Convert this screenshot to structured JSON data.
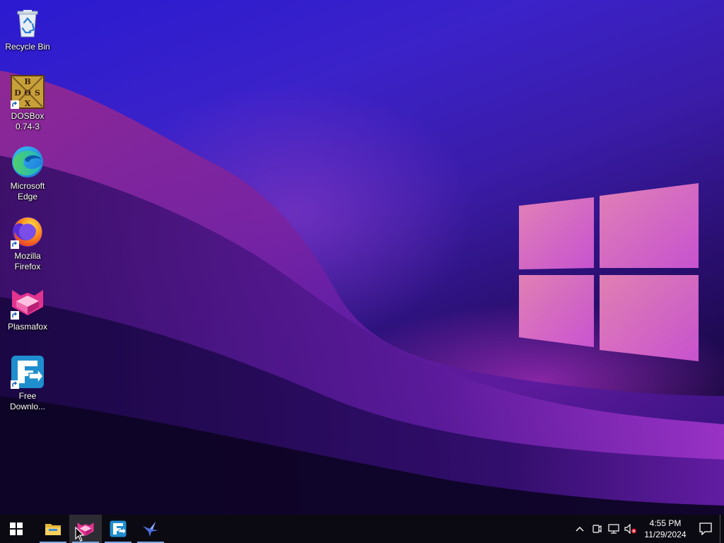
{
  "desktop": {
    "icons": [
      {
        "name": "recycle-bin",
        "label": "Recycle Bin",
        "icon": "recycle-bin-icon"
      },
      {
        "name": "dosbox",
        "label": "DOSBox\n0.74-3",
        "icon": "dosbox-icon",
        "shortcut": true
      },
      {
        "name": "microsoft-edge",
        "label": "Microsoft\nEdge",
        "icon": "edge-icon",
        "shortcut": true
      },
      {
        "name": "mozilla-firefox",
        "label": "Mozilla\nFirefox",
        "icon": "firefox-icon",
        "shortcut": true
      },
      {
        "name": "plasmafox",
        "label": "Plasmafox",
        "icon": "plasmafox-icon",
        "shortcut": true
      },
      {
        "name": "free-download-manager",
        "label": "Free\nDownlo...",
        "icon": "fdm-icon",
        "shortcut": true
      }
    ],
    "dosbox_logo_letters": [
      "B",
      "D",
      "O",
      "S",
      "X"
    ]
  },
  "taskbar": {
    "buttons": [
      {
        "name": "start-button",
        "icon": "windows-start-icon"
      },
      {
        "name": "file-explorer-button",
        "icon": "folder-icon",
        "running": true
      },
      {
        "name": "plasmafox-taskbar-button",
        "icon": "plasmafox-icon",
        "running": true,
        "active": true
      },
      {
        "name": "fdm-taskbar-button",
        "icon": "fdm-icon",
        "running": true
      },
      {
        "name": "bird-app-taskbar-button",
        "icon": "bird-icon",
        "running": true
      }
    ],
    "tray": {
      "icons": [
        "chevron-up-icon",
        "meet-now-icon",
        "network-icon",
        "volume-muted-icon"
      ],
      "time": "4:55 PM",
      "date": "11/29/2024",
      "notification_icon": "action-center-icon"
    }
  },
  "colors": {
    "taskbar_bg": "#0b0a12",
    "running_indicator": "#7aa7e0",
    "windows_logo": "#e57bd0"
  }
}
